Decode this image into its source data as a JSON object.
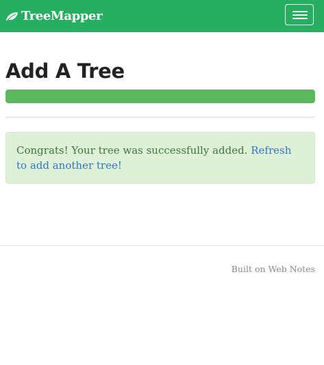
{
  "colors": {
    "brand": "#27ae60",
    "success": "#5cb85c",
    "alert_background": "#dff0d8",
    "alert_text": "#3c763d",
    "link": "#2f78c4"
  },
  "navbar": {
    "brand_icon": "leaf-icon",
    "brand_name": "TreeMapper",
    "toggle_icon": "hamburger-menu-icon"
  },
  "main": {
    "title": "Add A Tree",
    "progress_percent": 100,
    "alert": {
      "message": "Congrats! Your tree was successfully added.",
      "link_text": "Refresh to add another tree!"
    }
  },
  "footer": {
    "text": "Built on Web Notes"
  }
}
